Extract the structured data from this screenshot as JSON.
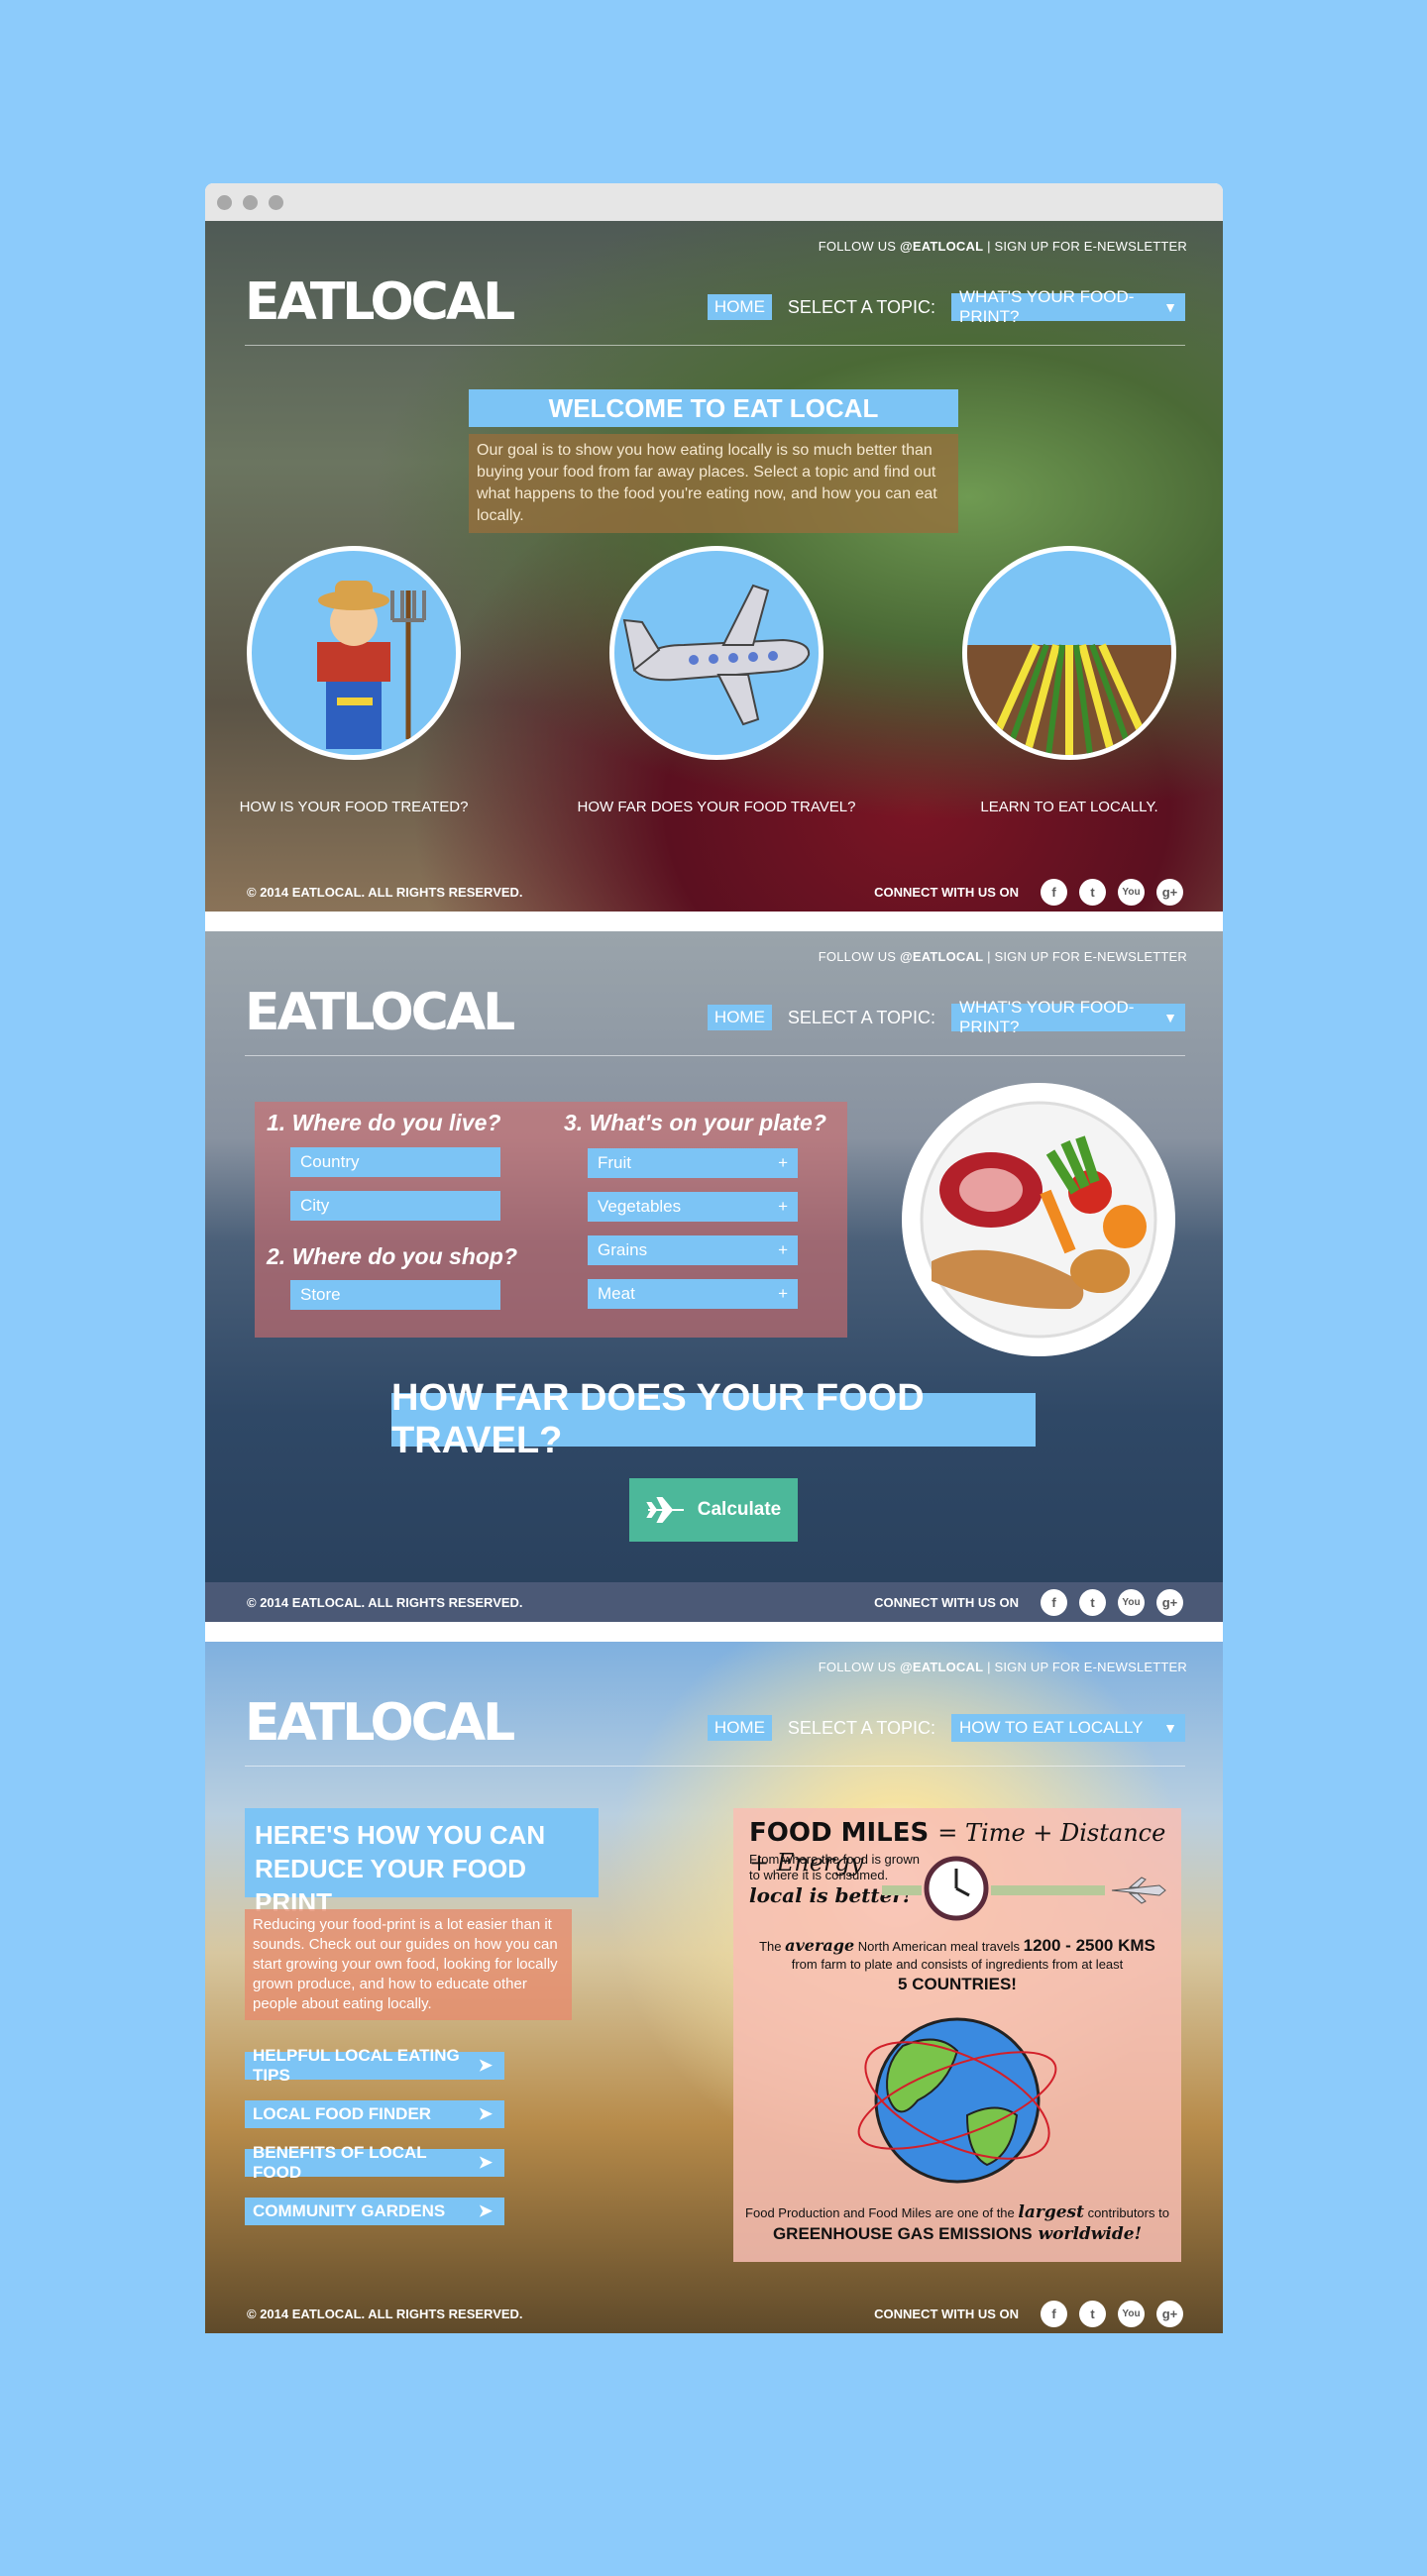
{
  "site": {
    "logo": "EATLOCAL",
    "follow_prefix": "FOLLOW US ",
    "follow_handle": "@EATLOCAL",
    "signup": " | SIGN UP FOR E-NEWSLETTER",
    "home": "HOME",
    "topic_label": "SELECT A TOPIC:",
    "copyright": "© 2014 EATLOCAL. ALL RIGHTS RESERVED.",
    "connect": "CONNECT WITH US ON",
    "social": [
      "f",
      "t",
      "You",
      "g+"
    ],
    "icons": [
      "facebook-icon",
      "twitter-icon",
      "youtube-icon",
      "google-plus-icon"
    ]
  },
  "panel1": {
    "topic": "WHAT'S YOUR FOOD-PRINT?",
    "welcome_title": "WELCOME TO EAT LOCAL",
    "welcome_text": "Our goal is to show you how eating locally is so much better than buying your food from far away places. Select a topic and find out what happens to the food you're eating now, and how you can eat locally.",
    "cards": [
      {
        "label": "HOW IS YOUR FOOD TREATED?",
        "icon": "farmer-icon"
      },
      {
        "label": "HOW FAR DOES YOUR FOOD TRAVEL?",
        "icon": "airplane-icon"
      },
      {
        "label": "LEARN TO EAT LOCALLY.",
        "icon": "farm-field-icon"
      }
    ]
  },
  "panel2": {
    "topic": "WHAT'S YOUR FOOD-PRINT?",
    "q1": "1. Where do you live?",
    "q2": "2. Where do you shop?",
    "q3": "3. What's on your plate?",
    "live_options": [
      "Country",
      "City"
    ],
    "shop_options": [
      "Store"
    ],
    "plate_options": [
      "Fruit",
      "Vegetables",
      "Grains",
      "Meat"
    ],
    "plus": "+",
    "travel_title": "HOW FAR DOES YOUR FOOD TRAVEL?",
    "calculate": "Calculate"
  },
  "panel3": {
    "topic": "HOW TO EAT LOCALLY",
    "reduce_title": "HERE'S HOW YOU CAN REDUCE YOUR FOOD PRINT",
    "reduce_text": "Reducing your food-print is a lot easier than it sounds. Check out our guides on how you can start growing your own food, looking for locally grown produce, and how to educate other people about eating locally.",
    "tips": [
      "HELPFUL LOCAL EATING TIPS",
      "LOCAL FOOD FINDER",
      "BENEFITS OF LOCAL FOOD",
      "COMMUNITY GARDENS"
    ],
    "info": {
      "title": "FOOD MILES",
      "formula": "= Time + Distance + Energy",
      "sub1": "From where the food is grown",
      "sub2": "to where it is consumed.",
      "local": "local is better!",
      "avg_pre": "The ",
      "avg_word": "average",
      "avg_mid": " North American meal travels ",
      "avg_kms": "1200 - 2500 KMS",
      "avg_line2": "from farm to plate and consists of ingredients from at least",
      "five": "5 COUNTRIES!",
      "b1_pre": "Food Production and Food Miles are one of the ",
      "b1_word": "largest",
      "b1_post": " contributors to",
      "b2": "GREENHOUSE GAS EMISSIONS",
      "b2_word": " worldwide!"
    }
  }
}
